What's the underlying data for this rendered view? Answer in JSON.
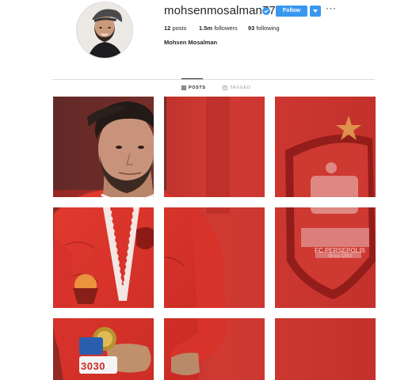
{
  "profile": {
    "username": "mohsenmosalman77",
    "follow_label": "Follow",
    "more_label": "···",
    "stats": {
      "posts_count": "12",
      "posts_label": "posts",
      "followers_count": "1.5m",
      "followers_label": "followers",
      "following_count": "93",
      "following_label": "following"
    },
    "full_name": "Mohsen Mosalman"
  },
  "tabs": [
    {
      "label": "POSTS",
      "icon": "grid-icon",
      "active": true
    },
    {
      "label": "TAGGED",
      "icon": "tag-icon",
      "active": false
    }
  ],
  "grid": {
    "rows": 3,
    "columns": 3,
    "tile_icons": [
      "photo-tile"
    ]
  },
  "photo_text": {
    "badge_line1": "FC PERSEPOLIS",
    "badge_line2": "Since 1963",
    "jersey_number": "3030"
  },
  "colors": {
    "accent": "#3897f0",
    "jersey_red": "#d8332a",
    "background_red": "#c9302c",
    "divider": "#dbdbdb"
  }
}
